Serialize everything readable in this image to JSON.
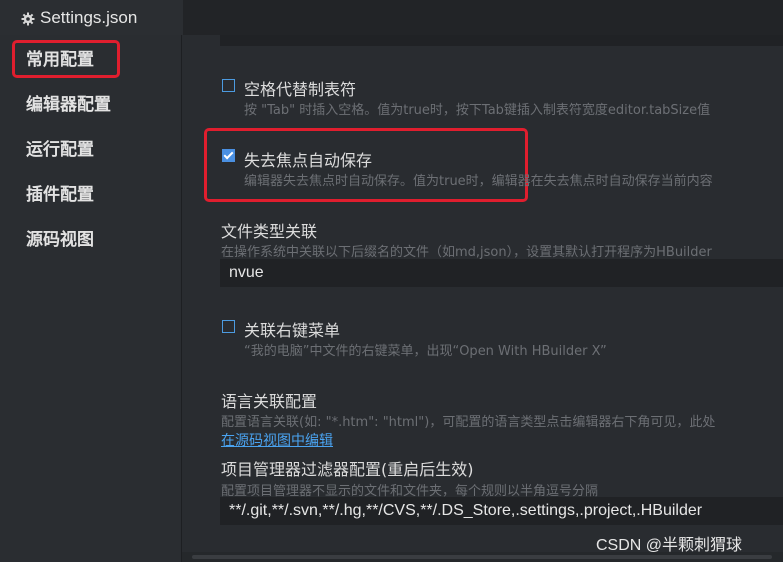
{
  "tab": {
    "title": "Settings.json",
    "icon": "gear-icon"
  },
  "sidebar": {
    "items": [
      {
        "label": "常用配置",
        "active": true
      },
      {
        "label": "编辑器配置"
      },
      {
        "label": "运行配置"
      },
      {
        "label": "插件配置"
      },
      {
        "label": "源码视图"
      }
    ]
  },
  "settings": {
    "top_input_value": "",
    "spaces_for_tabs": {
      "title": "空格代替制表符",
      "description": "按 \"Tab\" 时插入空格。值为true时，按下Tab键插入制表符宽度editor.tabSize值",
      "checked": false
    },
    "auto_save": {
      "title": "失去焦点自动保存",
      "description": "编辑器失去焦点时自动保存。值为true时，编辑器在失去焦点时自动保存当前内容",
      "checked": true
    },
    "file_association": {
      "title": "文件类型关联",
      "description": "在操作系统中关联以下后缀名的文件（如md,json），设置其默认打开程序为HBuilder",
      "value": "nvue"
    },
    "context_menu": {
      "title": "关联右键菜单",
      "description": "“我的电脑”中文件的右键菜单，出现“Open With HBuilder X”",
      "checked": false
    },
    "language_association": {
      "title": "语言关联配置",
      "description": "配置语言关联(如: \"*.htm\": \"html\")，可配置的语言类型点击编辑器右下角可见，此处",
      "link": "在源码视图中编辑"
    },
    "project_filter": {
      "title": "项目管理器过滤器配置(重启后生效)",
      "description": "配置项目管理器不显示的文件和文件夹，每个规则以半角逗号分隔",
      "value": "**/.git,**/.svn,**/.hg,**/CVS,**/.DS_Store,.settings,.project,.HBuilder"
    }
  },
  "watermark": "CSDN @半颗刺猬球",
  "colors": {
    "highlight": "#e01e2e",
    "accent": "#4a90e2",
    "link": "#4aa3f0"
  }
}
